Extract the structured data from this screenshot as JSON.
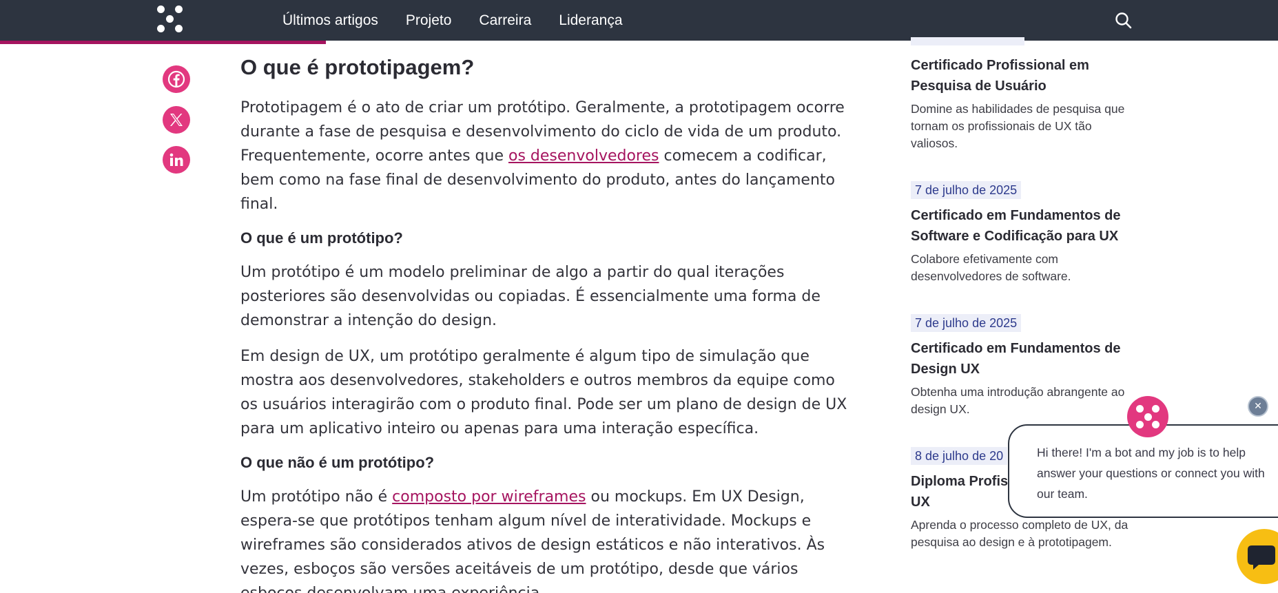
{
  "nav": {
    "items": [
      "Últimos artigos",
      "Projeto",
      "Carreira",
      "Liderança"
    ],
    "progress_fraction": 0.255
  },
  "icons": {
    "logo": "logo-icon",
    "search": "search-icon",
    "facebook": "facebook-icon",
    "x": "x-icon",
    "linkedin": "linkedin-icon",
    "chat": "chat-icon",
    "close": "close-icon"
  },
  "colors": {
    "nav_bg": "#2d3440",
    "accent": "#a5145f",
    "social": "#e2387f",
    "date_bg": "#eceef8",
    "chat_launcher": "#f7be13"
  },
  "article": {
    "heading": "O que é prototipagem?",
    "p1": {
      "before": "Prototipagem é o ato de criar um protótipo. Geralmente, a prototipagem ocorre durante a fase de pesquisa e desenvolvimento do ciclo de vida de um produto. Frequentemente, ocorre antes que ",
      "link": "os desenvolvedores",
      "after": " comecem a codificar, bem como na fase final de desenvolvimento do produto, antes do lançamento final."
    },
    "sub1": "O que é um protótipo?",
    "p2": "Um protótipo é um modelo preliminar de algo a partir do qual iterações posteriores são desenvolvidas ou copiadas. É essencialmente uma forma de demonstrar a intenção do design.",
    "p3": "Em design de UX, um protótipo geralmente é algum tipo de simulação que mostra aos desenvolvedores, stakeholders e outros membros da equipe como os usuários interagirão com o produto final. Pode ser um plano de design de UX para um aplicativo inteiro ou apenas para uma interação específica.",
    "sub2": "O que não é um protótipo?",
    "p4": {
      "before": "Um protótipo não é ",
      "link": "composto por wireframes",
      "after": " ou mockups. Em UX Design, espera-se que protótipos tenham algum nível de interatividade. Mockups e wireframes são considerados ativos de design estáticos e não interativos. Às vezes, esboços são versões aceitáveis de um protótipo, desde que vários esboços desenvolvam uma experiência."
    }
  },
  "sidebar": {
    "cards": [
      {
        "date": "",
        "title": "Certificado Profissional em Pesquisa de Usuário",
        "desc": "Domine as habilidades de pesquisa que tornam os profissionais de UX tão valiosos."
      },
      {
        "date": "7 de julho de 2025",
        "title": "Certificado em Fundamentos de Software e Codificação para UX",
        "desc": "Colabore efetivamente com desenvolvedores de software."
      },
      {
        "date": "7 de julho de 2025",
        "title": "Certificado em Fundamentos de Design UX",
        "desc": "Obtenha uma introdução abrangente ao design UX."
      },
      {
        "date": "8 de julho de 20",
        "title": "Diploma Profis UX",
        "desc": "Aprenda o processo completo de UX, da pesquisa ao design e à prototipagem."
      }
    ]
  },
  "chat": {
    "message": "Hi there! I'm a bot and my job is to help answer your questions or connect you with our team.",
    "close_label": "✕"
  }
}
